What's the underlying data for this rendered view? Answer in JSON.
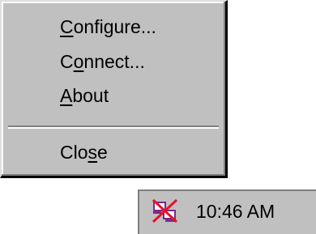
{
  "menu": {
    "items": [
      {
        "pre": "",
        "accel": "C",
        "post": "onfigure..."
      },
      {
        "pre": "C",
        "accel": "o",
        "post": "nnect..."
      },
      {
        "pre": "",
        "accel": "A",
        "post": "bout"
      },
      {
        "pre": "Clo",
        "accel": "s",
        "post": "e"
      }
    ]
  },
  "tray": {
    "clock": "10:46 AM",
    "icon": "disconnected-network-icon"
  },
  "colors": {
    "face": "#c0c0c0",
    "shadow": "#808080",
    "highlight": "#ffffff",
    "icon_red": "#e8102a",
    "icon_purple": "#7a2a8a"
  }
}
